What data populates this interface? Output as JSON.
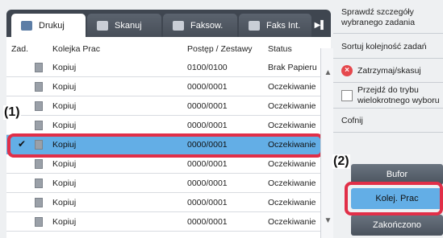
{
  "tabs": [
    {
      "label": "Drukuj",
      "active": true
    },
    {
      "label": "Skanuj",
      "active": false
    },
    {
      "label": "Faksow.",
      "active": false
    },
    {
      "label": "Faks Int.",
      "active": false
    }
  ],
  "tab_scroll_glyph": "▶▌",
  "columns": {
    "job": "Zad.",
    "queue": "Kolejka Prac",
    "progress": "Postęp / Zestawy",
    "status": "Status"
  },
  "rows": [
    {
      "name": "Kopiuj",
      "progress": "0100/0100",
      "status": "Brak Papieru",
      "selected": false
    },
    {
      "name": "Kopiuj",
      "progress": "0000/0001",
      "status": "Oczekiwanie",
      "selected": false
    },
    {
      "name": "Kopiuj",
      "progress": "0000/0001",
      "status": "Oczekiwanie",
      "selected": false
    },
    {
      "name": "Kopiuj",
      "progress": "0000/0001",
      "status": "Oczekiwanie",
      "selected": false
    },
    {
      "name": "Kopiuj",
      "progress": "0000/0001",
      "status": "Oczekiwanie",
      "selected": true
    },
    {
      "name": "Kopiuj",
      "progress": "0000/0001",
      "status": "Oczekiwanie",
      "selected": false
    },
    {
      "name": "Kopiuj",
      "progress": "0000/0001",
      "status": "Oczekiwanie",
      "selected": false
    },
    {
      "name": "Kopiuj",
      "progress": "0000/0001",
      "status": "Oczekiwanie",
      "selected": false
    },
    {
      "name": "Kopiuj",
      "progress": "0000/0001",
      "status": "Oczekiwanie",
      "selected": false
    }
  ],
  "panel": {
    "details_line1": "Sprawdź szczegóły",
    "details_line2": "wybranego zadania",
    "sort": "Sortuj kolejność zadań",
    "stop": "Zatrzymaj/skasuj",
    "multi_line1": "Przejdź do trybu",
    "multi_line2": "wielokrotnego wyboru",
    "cancel": "Cofnij",
    "bufor": "Bufor",
    "kolej": "Kolej. Prac",
    "done": "Zakończono"
  },
  "callouts": {
    "one": "(1)",
    "two": "(2)"
  },
  "colors": {
    "selected": "#63aee6",
    "highlight": "#e12f48",
    "tabbar": "#3f4650"
  }
}
